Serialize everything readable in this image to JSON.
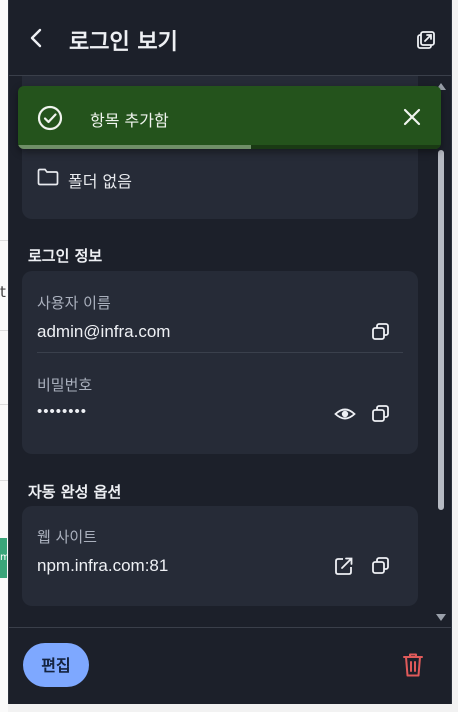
{
  "header": {
    "title": "로그인 보기",
    "back_icon": "chevron-left-icon",
    "popout_icon": "popout-icon"
  },
  "toast": {
    "message": "항목 추가함",
    "progress": 0.55,
    "color": "#24531c"
  },
  "folder": {
    "label": "폴더 없음"
  },
  "login_section": {
    "heading": "로그인 정보",
    "username_label": "사용자 이름",
    "username_value": "admin@infra.com",
    "password_label": "비밀번호",
    "password_value": "••••••••"
  },
  "autofill_section": {
    "heading": "자동 완성 옵션",
    "website_label": "웹 사이트",
    "website_value": "npm.infra.com:81"
  },
  "footer": {
    "edit_label": "편집",
    "delete_icon": "trash-icon",
    "accent": "#7ea8ff",
    "danger": "#e05a5a"
  },
  "background": {
    "fragment_t": "t",
    "fragment_m": "m"
  }
}
